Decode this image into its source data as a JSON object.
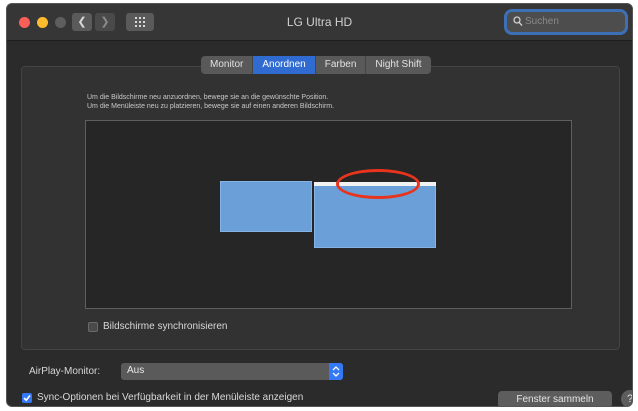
{
  "window": {
    "title": "LG Ultra HD"
  },
  "toolbar": {
    "back_icon": "chevron-left-icon",
    "forward_icon": "chevron-right-icon",
    "grid_icon": "grid-icon",
    "search_placeholder": "Suchen"
  },
  "tabs": [
    {
      "label": "Monitor",
      "active": false
    },
    {
      "label": "Anordnen",
      "active": true
    },
    {
      "label": "Farben",
      "active": false
    },
    {
      "label": "Night Shift",
      "active": false
    }
  ],
  "description": {
    "line1": "Um die Bildschirme neu anzuordnen, bewege sie an die gewünschte Position.",
    "line2": "Um die Menüleiste neu zu platzieren, bewege sie auf einen anderen Bildschirm."
  },
  "arrangement": {
    "displays": [
      "display-1",
      "display-2"
    ],
    "menubar_on": "display-2"
  },
  "mirror": {
    "label": "Bildschirme synchronisieren",
    "checked": false
  },
  "airplay": {
    "label": "AirPlay-Monitor:",
    "value": "Aus"
  },
  "sync": {
    "label": "Sync-Optionen bei Verfügbarkeit in der Menüleiste anzeigen",
    "checked": true
  },
  "gather_button": {
    "label": "Fenster sammeln"
  },
  "help_button": {
    "label": "?"
  },
  "colors": {
    "accent": "#2f6bd0",
    "display": "#6a9fd8",
    "annotation": "#e8341c"
  }
}
